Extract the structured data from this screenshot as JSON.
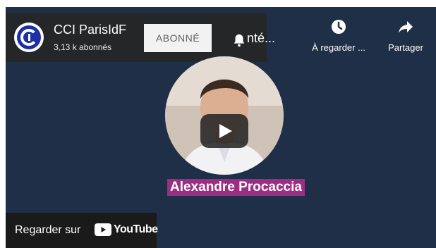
{
  "channel": {
    "name": "CCI ParisIdF",
    "subscribers": "3,13 k abonnés",
    "subscribe_label": "ABONNÉ"
  },
  "video": {
    "title_fragment": "nté...",
    "speaker_label": "Alexandre Procaccia"
  },
  "actions": {
    "watch_later": "À regarder ...",
    "share": "Partager"
  },
  "watch_on": {
    "label": "Regarder sur",
    "brand": "YouTube"
  },
  "colors": {
    "background": "#1f2f48",
    "speaker_label_bg": "#9c2d85",
    "brand_blue": "#1c2fa8"
  },
  "icons": [
    "cci-logo",
    "bell-icon",
    "clock-icon",
    "share-icon",
    "play-icon",
    "youtube-icon"
  ]
}
